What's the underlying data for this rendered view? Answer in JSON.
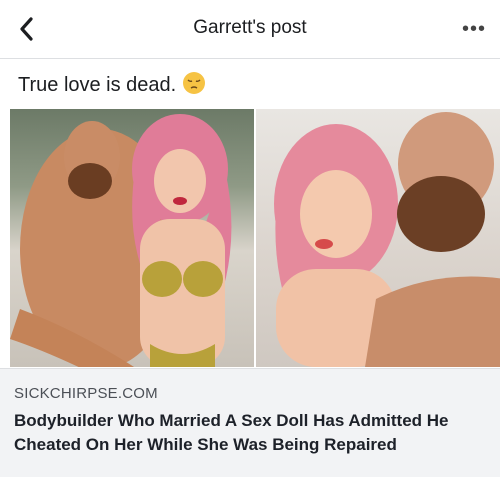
{
  "header": {
    "title": "Garrett's post",
    "back_icon": "chevron-left-icon",
    "more_icon": "more-dots-icon"
  },
  "post": {
    "text": "True love is dead.",
    "emoji": "pensive-face-emoji"
  },
  "link_preview": {
    "domain": "SICKCHIRPSE.COM",
    "headline": "Bodybuilder Who Married A Sex Doll Has Admitted He Cheated On Her While She Was Being Repaired"
  },
  "colors": {
    "background": "#ffffff",
    "link_box": "#f2f3f5",
    "doll_hair": "#e58a9c",
    "skin": "#d9a07e"
  }
}
